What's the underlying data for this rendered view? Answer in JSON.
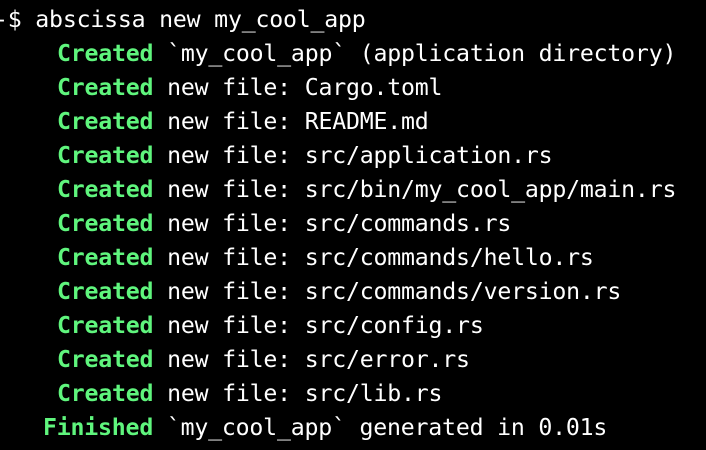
{
  "colors": {
    "background": "#000000",
    "text": "#ffffff",
    "status_green": "#5ff57d"
  },
  "prompt": {
    "symbol": "-$",
    "command": "abscissa new my_cool_app"
  },
  "output": [
    {
      "status": "Created",
      "message": "`my_cool_app` (application directory)"
    },
    {
      "status": "Created",
      "message": "new file: Cargo.toml"
    },
    {
      "status": "Created",
      "message": "new file: README.md"
    },
    {
      "status": "Created",
      "message": "new file: src/application.rs"
    },
    {
      "status": "Created",
      "message": "new file: src/bin/my_cool_app/main.rs"
    },
    {
      "status": "Created",
      "message": "new file: src/commands.rs"
    },
    {
      "status": "Created",
      "message": "new file: src/commands/hello.rs"
    },
    {
      "status": "Created",
      "message": "new file: src/commands/version.rs"
    },
    {
      "status": "Created",
      "message": "new file: src/config.rs"
    },
    {
      "status": "Created",
      "message": "new file: src/error.rs"
    },
    {
      "status": "Created",
      "message": "new file: src/lib.rs"
    }
  ],
  "finish": {
    "status": "Finished",
    "message": "`my_cool_app` generated in 0.01s"
  }
}
